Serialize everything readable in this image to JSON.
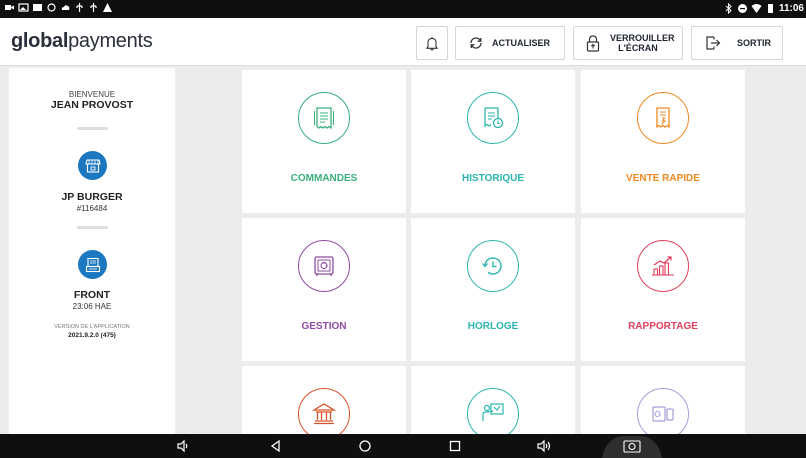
{
  "header": {
    "logo_bold": "global",
    "logo_light": "payments",
    "refresh_label": "ACTUALISER",
    "lock_label_1": "VERROUILLER",
    "lock_label_2": "L'ÉCRAN",
    "exit_label": "SORTIR"
  },
  "status_bar": {
    "time": "11:06"
  },
  "sidebar": {
    "welcome": "BIENVENUE",
    "user_name": "JEAN PROVOST",
    "store_name": "JP BURGER",
    "store_id": "#116484",
    "terminal_name": "FRONT",
    "terminal_time": "23:06 HAE",
    "version_label": "VERSION DE L'APPLICATION",
    "version_value": "2021.9.2.0 (475)"
  },
  "tiles": [
    {
      "label": "COMMANDES",
      "color": "#3aaf7a",
      "icon": "orders-receipt-icon"
    },
    {
      "label": "HISTORIQUE",
      "color": "#2bb6ad",
      "icon": "history-receipt-icon"
    },
    {
      "label": "VENTE RAPIDE",
      "color": "#f08a24",
      "icon": "quick-sale-icon"
    },
    {
      "label": "GESTION",
      "color": "#8e4ba3",
      "icon": "management-safe-icon"
    },
    {
      "label": "HORLOGE",
      "color": "#2bb6ad",
      "icon": "clock-icon"
    },
    {
      "label": "RAPPORTAGE",
      "color": "#e0405a",
      "icon": "reporting-chart-icon"
    },
    {
      "label": "",
      "color": "#d9532c",
      "icon": "bank-icon"
    },
    {
      "label": "",
      "color": "#2bb6ad",
      "icon": "training-icon"
    },
    {
      "label": "",
      "color": "#a89bd6",
      "icon": "devices-icon"
    }
  ]
}
